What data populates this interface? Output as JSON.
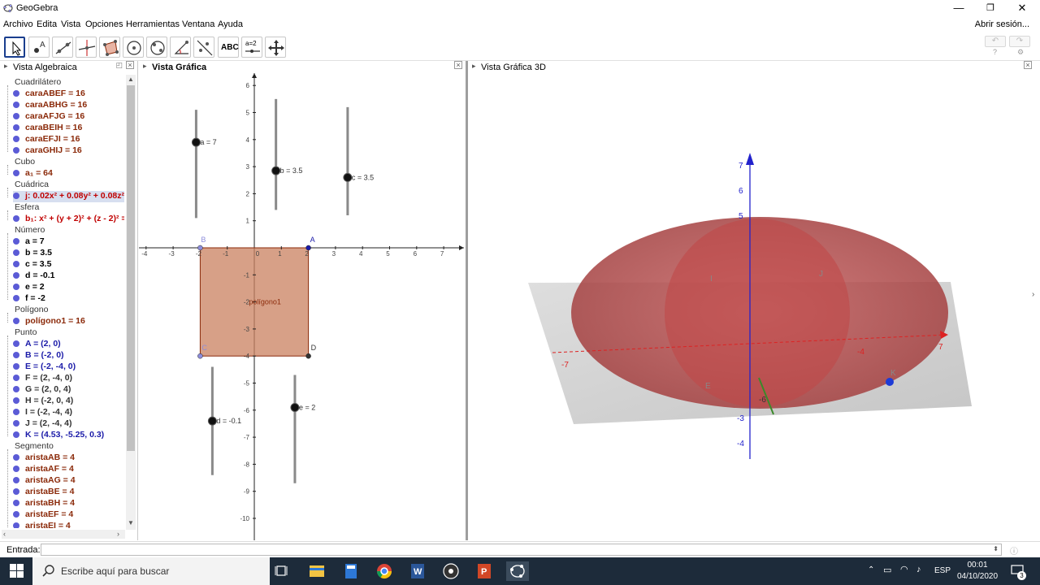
{
  "window": {
    "title": "GeoGebra",
    "minimize": "—",
    "maximize": "❐",
    "close": "✕"
  },
  "menu": {
    "items": [
      "Archivo",
      "Edita",
      "Vista",
      "Opciones",
      "Herramientas",
      "Ventana",
      "Ayuda"
    ],
    "signin": "Abrir sesión..."
  },
  "toolbar": {
    "tools": [
      "move-tool",
      "point-tool",
      "line-tool",
      "perpendicular-tool",
      "polygon-tool",
      "circle-tool",
      "conic-tool",
      "angle-tool",
      "reflect-tool",
      "text-tool",
      "slider-tool",
      "move-view-tool"
    ],
    "text_tool_label": "ABC",
    "slider_tool_label": "a=2",
    "undo": "↶",
    "redo": "↷"
  },
  "algebra": {
    "title": "Vista Algebraica",
    "groups": [
      {
        "name": "Cuadrilátero",
        "items": [
          {
            "text": "caraABEF = 16",
            "color": "#8b2a0a"
          },
          {
            "text": "caraABHG = 16",
            "color": "#8b2a0a"
          },
          {
            "text": "caraAFJG = 16",
            "color": "#8b2a0a"
          },
          {
            "text": "caraBEIH = 16",
            "color": "#8b2a0a"
          },
          {
            "text": "caraEFJI = 16",
            "color": "#8b2a0a"
          },
          {
            "text": "caraGHIJ = 16",
            "color": "#8b2a0a"
          }
        ]
      },
      {
        "name": "Cubo",
        "items": [
          {
            "text": "a₁ = 64",
            "color": "#8b2a0a"
          }
        ]
      },
      {
        "name": "Cuádrica",
        "items": [
          {
            "text": "j: 0.02x² + 0.08y² + 0.08z²",
            "color": "#c00000",
            "highlight": true
          }
        ]
      },
      {
        "name": "Esfera",
        "items": [
          {
            "text": "b₁: x² + (y + 2)² + (z - 2)² =",
            "color": "#c00000"
          }
        ]
      },
      {
        "name": "Número",
        "items": [
          {
            "text": "a = 7",
            "color": "#000"
          },
          {
            "text": "b = 3.5",
            "color": "#000"
          },
          {
            "text": "c = 3.5",
            "color": "#000"
          },
          {
            "text": "d = -0.1",
            "color": "#000"
          },
          {
            "text": "e = 2",
            "color": "#000"
          },
          {
            "text": "f = -2",
            "color": "#000"
          }
        ]
      },
      {
        "name": "Polígono",
        "items": [
          {
            "text": "polígono1 = 16",
            "color": "#8b2a0a"
          }
        ]
      },
      {
        "name": "Punto",
        "items": [
          {
            "text": "A = (2, 0)",
            "color": "#1a1aa8"
          },
          {
            "text": "B = (-2, 0)",
            "color": "#1a1aa8"
          },
          {
            "text": "E = (-2, -4, 0)",
            "color": "#1a1aa8"
          },
          {
            "text": "F = (2, -4, 0)",
            "color": "#333"
          },
          {
            "text": "G = (2, 0, 4)",
            "color": "#333"
          },
          {
            "text": "H = (-2, 0, 4)",
            "color": "#333"
          },
          {
            "text": "I = (-2, -4, 4)",
            "color": "#333"
          },
          {
            "text": "J = (2, -4, 4)",
            "color": "#333"
          },
          {
            "text": "K = (4.53, -5.25, 0.3)",
            "color": "#1a1aa8"
          }
        ]
      },
      {
        "name": "Segmento",
        "items": [
          {
            "text": "aristaAB = 4",
            "color": "#8b2a0a"
          },
          {
            "text": "aristaAF = 4",
            "color": "#8b2a0a"
          },
          {
            "text": "aristaAG = 4",
            "color": "#8b2a0a"
          },
          {
            "text": "aristaBE = 4",
            "color": "#8b2a0a"
          },
          {
            "text": "aristaBH = 4",
            "color": "#8b2a0a"
          },
          {
            "text": "aristaEF = 4",
            "color": "#8b2a0a"
          },
          {
            "text": "aristaEI = 4",
            "color": "#8b2a0a"
          }
        ]
      }
    ]
  },
  "graphics": {
    "title": "Vista Gráfica",
    "x_ticks": [
      "-4",
      "-3",
      "-2",
      "-1",
      "0",
      "1",
      "2",
      "3",
      "4",
      "5",
      "6",
      "7"
    ],
    "y_ticks": [
      "6",
      "5",
      "4",
      "3",
      "2",
      "1",
      "-1",
      "-2",
      "-3",
      "-4",
      "-5",
      "-6",
      "-7",
      "-8",
      "-9",
      "-10"
    ],
    "sliders": [
      {
        "label": "a = 7"
      },
      {
        "label": "b = 3.5"
      },
      {
        "label": "c = 3.5"
      },
      {
        "label": "d = -0.1"
      },
      {
        "label": "e = 2"
      }
    ],
    "points": [
      "A",
      "B",
      "C",
      "D"
    ],
    "polygon_label": "polígono1",
    "polygon_color": "#c9805f"
  },
  "graphics3d": {
    "title": "Vista Gráfica 3D",
    "z_ticks": [
      "7",
      "6",
      "5",
      "-3",
      "-4"
    ],
    "x_ticks": [
      "-7",
      "7",
      "-4",
      "-6"
    ],
    "point_labels": [
      "I",
      "J",
      "K",
      "E"
    ],
    "surface_color": "#b53a3a"
  },
  "inputbar": {
    "label": "Entrada:"
  },
  "taskbar": {
    "search_placeholder": "Escribe aquí para buscar",
    "lang": "ESP",
    "time": "00:01",
    "date": "04/10/2020",
    "notification_count": "3"
  }
}
